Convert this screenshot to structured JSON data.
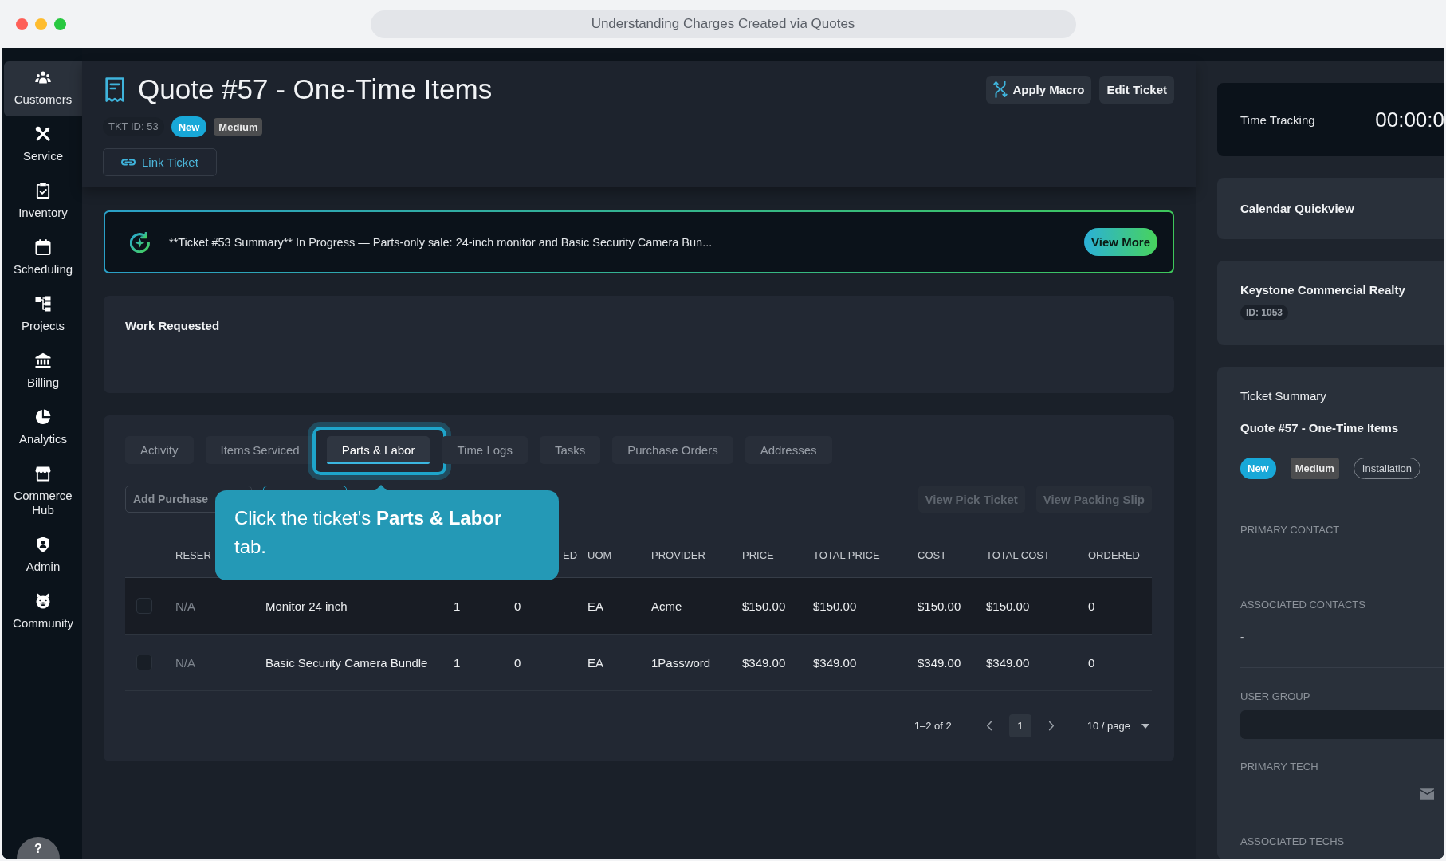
{
  "window": {
    "title": "Understanding Charges Created via Quotes"
  },
  "sidebar": {
    "items": [
      {
        "label": "Customers",
        "selected": true
      },
      {
        "label": "Service",
        "selected": false
      },
      {
        "label": "Inventory",
        "selected": false
      },
      {
        "label": "Scheduling",
        "selected": false
      },
      {
        "label": "Projects",
        "selected": false
      },
      {
        "label": "Billing",
        "selected": false
      },
      {
        "label": "Analytics",
        "selected": false
      },
      {
        "label": "Commerce Hub",
        "selected": false
      },
      {
        "label": "Admin",
        "selected": false
      },
      {
        "label": "Community",
        "selected": false
      }
    ],
    "help": "?"
  },
  "ticket": {
    "title": "Quote #57 - One-Time Items",
    "id": "TKT ID: 53",
    "badges": [
      {
        "kind": "status",
        "label": "New"
      },
      {
        "kind": "priority",
        "label": "Medium"
      }
    ],
    "link_button": "Link Ticket",
    "actions": {
      "apply_macro": "Apply Macro",
      "edit_ticket": "Edit Ticket"
    }
  },
  "summary_banner": {
    "text": "**Ticket #53 Summary** In Progress — Parts-only sale: 24-inch monitor and Basic Security Camera Bun...",
    "button": "View More"
  },
  "work_requested": {
    "title": "Work Requested"
  },
  "tabs": [
    {
      "label": "Activity",
      "selected": false
    },
    {
      "label": "Items Serviced",
      "selected": false
    },
    {
      "label": "Parts & Labor",
      "selected": true
    },
    {
      "label": "Time Logs",
      "selected": false
    },
    {
      "label": "Tasks",
      "selected": false
    },
    {
      "label": "Purchase Orders",
      "selected": false
    },
    {
      "label": "Addresses",
      "selected": false
    }
  ],
  "toolbar": {
    "left_buttons": [
      {
        "kind": "default",
        "label": "Add Purchase"
      },
      {
        "kind": "primary"
      }
    ],
    "right_buttons": [
      {
        "label": "View Pick Ticket",
        "disabled": true
      },
      {
        "label": "View Packing Slip",
        "disabled": true
      }
    ]
  },
  "table": {
    "columns": [
      "RESER",
      "",
      "",
      "ED",
      "UOM",
      "PROVIDER",
      "PRICE",
      "TOTAL PRICE",
      "COST",
      "TOTAL COST",
      "ORDERED"
    ],
    "rows": [
      {
        "checked": false,
        "hovered": true,
        "cells": [
          "N/A",
          "Monitor 24 inch",
          "1",
          "0",
          "EA",
          "Acme",
          "$150.00",
          "$150.00",
          "$150.00",
          "$150.00",
          "0"
        ]
      },
      {
        "checked": false,
        "hovered": false,
        "cells": [
          "N/A",
          "Basic Security Camera Bundle",
          "1",
          "0",
          "EA",
          "1Password",
          "$349.00",
          "$349.00",
          "$349.00",
          "$349.00",
          "0"
        ]
      }
    ]
  },
  "pagination": {
    "range": "1–2 of 2",
    "pages": [
      {
        "label": "1",
        "selected": true
      }
    ],
    "page_size": "10 / page"
  },
  "tooltip": {
    "text": "Click the ticket's **Parts & Labor** tab."
  },
  "right_panel": {
    "time_tracking": {
      "label": "Time Tracking",
      "timer": "00:00:0"
    },
    "calendar": {
      "title": "Calendar Quickview"
    },
    "customer": {
      "name": "Keystone Commercial Realty",
      "id": "ID: 1053"
    },
    "ticket_summary": {
      "title": "Ticket Summary",
      "name": "Quote #57 - One-Time Items",
      "badges": [
        {
          "kind": "status",
          "label": "New"
        },
        {
          "kind": "priority",
          "label": "Medium"
        },
        {
          "kind": "tag",
          "label": "Installation"
        }
      ],
      "sections": [
        {
          "fields": [
            {
              "kind": "text",
              "label": "PRIMARY CONTACT"
            },
            {
              "kind": "text",
              "label": "ASSOCIATED CONTACTS",
              "value": "-"
            }
          ]
        },
        {
          "fields": [
            {
              "kind": "input",
              "label": "USER GROUP"
            },
            {
              "kind": "contact",
              "label": "PRIMARY TECH"
            },
            {
              "kind": "text",
              "label": "ASSOCIATED TECHS"
            }
          ]
        }
      ]
    }
  }
}
